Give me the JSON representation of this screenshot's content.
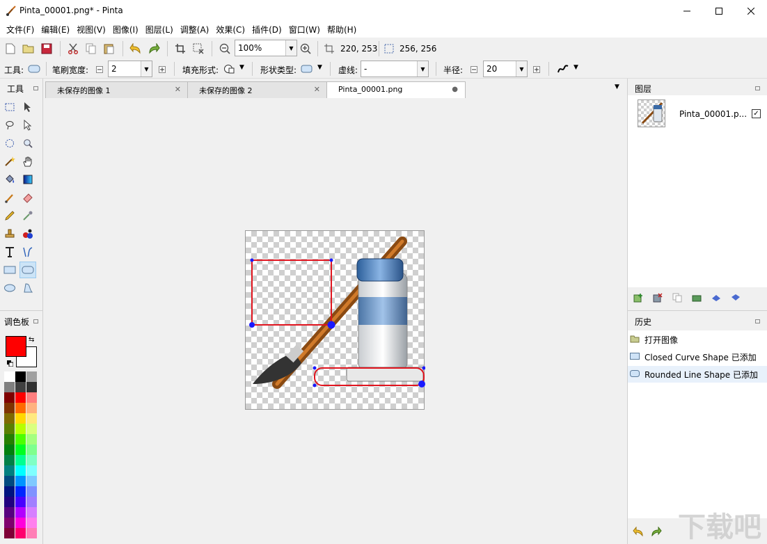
{
  "window": {
    "title": "Pinta_00001.png* - Pinta"
  },
  "menu": [
    "文件(F)",
    "编辑(E)",
    "视图(V)",
    "图像(I)",
    "图层(L)",
    "调整(A)",
    "效果(C)",
    "插件(D)",
    "窗口(W)",
    "帮助(H)"
  ],
  "toolbar": {
    "zoom": "100%",
    "cursor_pos": "220, 253",
    "selection_size": "256, 256"
  },
  "options": {
    "tool_label": "工具:",
    "brush_width_label": "笔刷宽度:",
    "brush_width": "2",
    "fill_label": "填充形式:",
    "shape_type_label": "形状类型:",
    "dash_label": "虚线:",
    "dash": "-",
    "radius_label": "半径:",
    "radius": "20"
  },
  "panels": {
    "tools": "工具",
    "palette": "调色板",
    "layers": "图层",
    "history": "历史"
  },
  "tabs": [
    "未保存的图像 1",
    "未保存的图像 2",
    "Pinta_00001.png"
  ],
  "layers": [
    {
      "name": "Pinta_00001.p...",
      "visible": true
    }
  ],
  "history": [
    {
      "label": "打开图像",
      "icon": "folder-icon"
    },
    {
      "label": "Closed Curve Shape 已添加",
      "icon": "closed-curve-icon"
    },
    {
      "label": "Rounded Line Shape 已添加",
      "icon": "rounded-line-icon"
    }
  ],
  "colors": {
    "primary": "#ff0000",
    "secondary": "#ffffff",
    "selection": "#cce4f7",
    "shape_stroke": "#e0141e",
    "handle": "#1a1aff"
  },
  "watermark": "下载吧"
}
